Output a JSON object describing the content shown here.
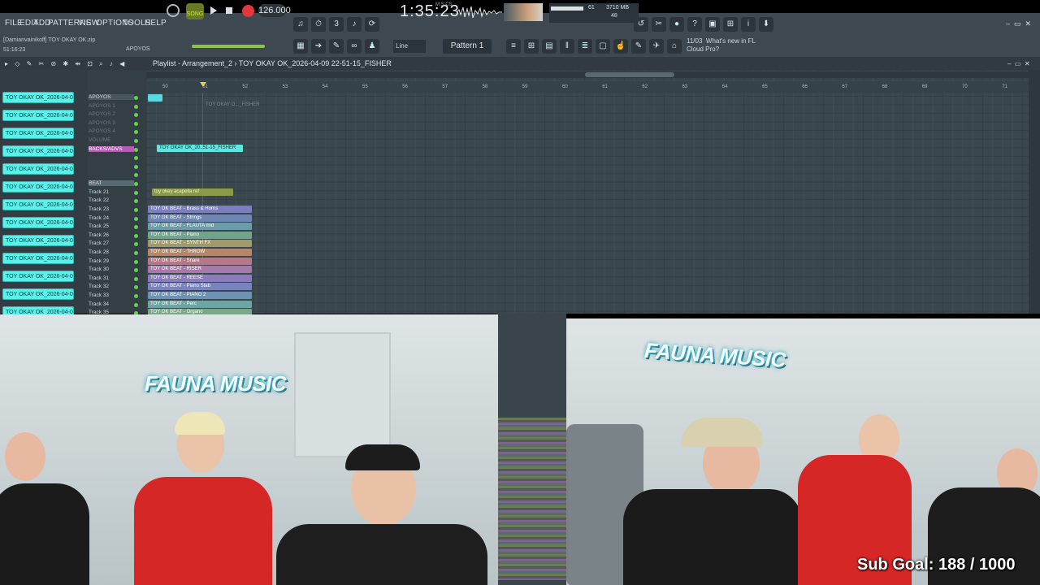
{
  "menu": [
    "FILE",
    "EDIT",
    "ADD",
    "PATTERNS",
    "VIEW",
    "OPTIONS",
    "TOOLS",
    "HELP"
  ],
  "transport": {
    "mode": "SONG",
    "tempo": "126.000",
    "time": "1:35:23",
    "time_unit": "M:S:CS"
  },
  "cpu": {
    "value": "61",
    "memory": "3710 MB",
    "poly": "48"
  },
  "hint_user": "[Damianvainikoff] TOY OKAY OK.zip",
  "hint_time": "51:16:23",
  "hint_track": "APOYOS",
  "snap": "Line",
  "pattern": "Pattern 1",
  "news": {
    "date": "11/03",
    "line1": "What's new in FL",
    "line2": "Cloud Pro?"
  },
  "playlist": {
    "title": "Playlist - Arrangement_2",
    "path": "TOY OKAY OK_2026-04-09 22-51-15_FISHER"
  },
  "ruler": [
    "50",
    "51",
    "52",
    "53",
    "54",
    "55",
    "56",
    "57",
    "58",
    "59",
    "60",
    "61",
    "62",
    "63",
    "64",
    "65",
    "66",
    "67",
    "68",
    "69",
    "70",
    "71"
  ],
  "files": [
    "TOY OKAY OK_2026-04-0...",
    "TOY OKAY OK_2026-04-0...",
    "TOY OKAY OK_2026-04-0...",
    "TOY OKAY OK_2026-04-0...",
    "TOY OKAY OK_2026-04-0...",
    "TOY OKAY OK_2026-04-0...",
    "TOY OKAY OK_2026-04-0...",
    "TOY OKAY OK_2026-04-0...",
    "TOY OKAY OK_2026-04-0...",
    "TOY OKAY OK_2026-04-0...",
    "TOY OKAY OK_2026-04-0...",
    "TOY OKAY OK_2026-04-0...",
    "TOY OKAY OK_2026-04-0...",
    "TOY OKAY OK_2026-04-0..."
  ],
  "tracks": {
    "apoyos": "APOYOS",
    "backs": "BACKS/ADVS",
    "beat": "BEAT",
    "t21": "Track 21",
    "t22": "Track 22",
    "t23": "Track 23",
    "t24": "Track 24",
    "t25": "Track 25",
    "t26": "Track 26",
    "t27": "Track 27",
    "t28": "Track 28",
    "t29": "Track 29",
    "t30": "Track 30",
    "t31": "Track 31",
    "t32": "Track 32",
    "t33": "Track 33",
    "t34": "Track 34",
    "t35": "Track 35"
  },
  "clips": {
    "backs": "TOY OKAY OK_20..51-15_FISHER",
    "ghost": "TOY OKAY O..._FISHER",
    "acapella": "toy okey acapella ref",
    "c23": "TOY OK BEAT - Brass & Horns",
    "c24": "TOY OK BEAT - Strings",
    "c25": "TOY OK BEAT - FLAUTA mid",
    "c26": "TOY OK BEAT - Piano",
    "c27": "TOY OK BEAT - SYNTH FX",
    "c28": "TOY OK BEAT - THROW",
    "c29": "TOY OK BEAT - Snare",
    "c30": "TOY OK BEAT - RISER",
    "c31": "TOY OK BEAT - REESE",
    "c32": "TOY OK BEAT - Piano Stab",
    "c33": "TOY OK BEAT - PIANO 2",
    "c34": "TOY OK BEAT - Perc",
    "c35": "TOY OK BEAT - Organo"
  },
  "cam": {
    "brand_left": "FAUNA MUSIC",
    "brand_right": "FAUNA MUSIC",
    "sub_goal": "Sub Goal:  188 / 1000"
  }
}
